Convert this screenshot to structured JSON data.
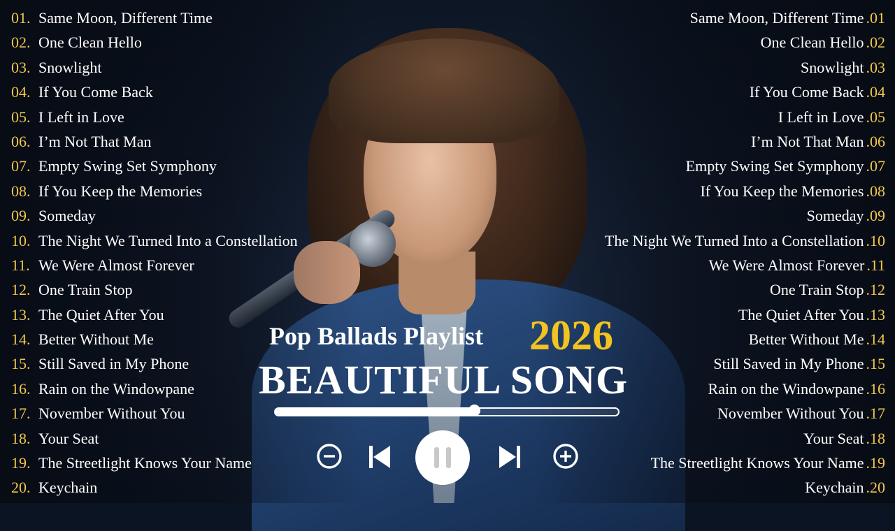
{
  "tracklist": [
    {
      "num": "01.",
      "title": "Same Moon, Different Time"
    },
    {
      "num": "02.",
      "title": "One Clean Hello"
    },
    {
      "num": "03.",
      "title": "Snowlight"
    },
    {
      "num": "04.",
      "title": "If You Come Back"
    },
    {
      "num": "05.",
      "title": "I Left in Love"
    },
    {
      "num": "06.",
      "title": "I’m Not That Man"
    },
    {
      "num": "07.",
      "title": "Empty Swing Set Symphony"
    },
    {
      "num": "08.",
      "title": "If You Keep the Memories"
    },
    {
      "num": "09.",
      "title": "Someday"
    },
    {
      "num": "10.",
      "title": "The Night We Turned Into a Constellation"
    },
    {
      "num": "11.",
      "title": "We Were Almost Forever"
    },
    {
      "num": "12.",
      "title": "One Train Stop"
    },
    {
      "num": "13.",
      "title": "The Quiet After You"
    },
    {
      "num": "14.",
      "title": "Better Without Me"
    },
    {
      "num": "15.",
      "title": "Still Saved in My Phone"
    },
    {
      "num": "16.",
      "title": "Rain on the Windowpane"
    },
    {
      "num": "17.",
      "title": "November Without You"
    },
    {
      "num": "18.",
      "title": "Your Seat"
    },
    {
      "num": "19.",
      "title": "The Streetlight Knows Your Name"
    },
    {
      "num": "20.",
      "title": "Keychain"
    }
  ],
  "tracklist_mirror": [
    {
      "num": ".01",
      "title": "Same Moon, Different Time"
    },
    {
      "num": ".02",
      "title": "One Clean Hello"
    },
    {
      "num": ".03",
      "title": "Snowlight"
    },
    {
      "num": ".04",
      "title": "If You Come Back"
    },
    {
      "num": ".05",
      "title": "I Left in Love"
    },
    {
      "num": ".06",
      "title": "I’m Not That Man"
    },
    {
      "num": ".07",
      "title": "Empty Swing Set Symphony"
    },
    {
      "num": ".08",
      "title": "If You Keep the Memories"
    },
    {
      "num": ".09",
      "title": "Someday"
    },
    {
      "num": ".10",
      "title": "The Night We Turned Into a Constellation"
    },
    {
      "num": ".11",
      "title": "We Were Almost Forever"
    },
    {
      "num": ".12",
      "title": "One Train Stop"
    },
    {
      "num": ".13",
      "title": "The Quiet After You"
    },
    {
      "num": ".14",
      "title": "Better Without Me"
    },
    {
      "num": ".15",
      "title": "Still Saved in My Phone"
    },
    {
      "num": ".16",
      "title": "Rain on the Windowpane"
    },
    {
      "num": ".17",
      "title": "November Without You"
    },
    {
      "num": ".18",
      "title": "Your Seat"
    },
    {
      "num": ".19",
      "title": "The Streetlight Knows Your Name"
    },
    {
      "num": ".20",
      "title": "Keychain"
    }
  ],
  "header": {
    "playlist_title": "Pop Ballads Playlist",
    "year": "2026",
    "main_title": "BEAUTIFUL SONG"
  },
  "player": {
    "progress": 0.58,
    "controls": [
      "minus-circle-icon",
      "skip-previous-icon",
      "pause-icon",
      "skip-next-icon",
      "plus-circle-icon"
    ]
  },
  "colors": {
    "accent": "#f2c321",
    "track_number": "#f2c94c",
    "text": "#ffffff",
    "background": "#0b1422",
    "suit": "#2f5488"
  }
}
